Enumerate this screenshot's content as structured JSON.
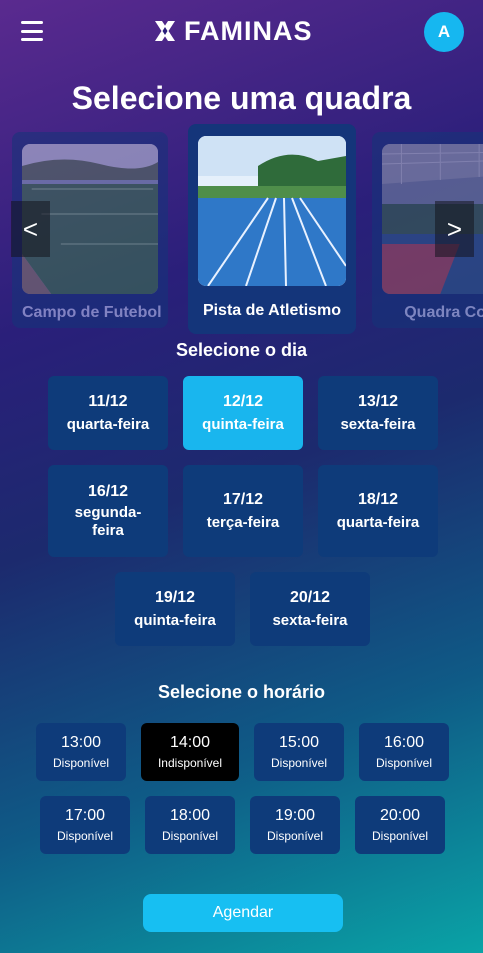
{
  "header": {
    "brand": "FAMINAS",
    "avatar_initial": "A"
  },
  "title": "Selecione uma quadra",
  "courts": [
    {
      "name": "Campo de Futebol"
    },
    {
      "name": "Pista de Atletismo"
    },
    {
      "name": "Quadra Cob"
    }
  ],
  "carousel": {
    "prev": "<",
    "next": ">"
  },
  "day_section": {
    "title": "Selecione o dia",
    "days": [
      {
        "date": "11/12",
        "weekday": "quarta-feira"
      },
      {
        "date": "12/12",
        "weekday": "quinta-feira"
      },
      {
        "date": "13/12",
        "weekday": "sexta-feira"
      },
      {
        "date": "16/12",
        "weekday": "segunda-feira"
      },
      {
        "date": "17/12",
        "weekday": "terça-feira"
      },
      {
        "date": "18/12",
        "weekday": "quarta-feira"
      },
      {
        "date": "19/12",
        "weekday": "quinta-feira"
      },
      {
        "date": "20/12",
        "weekday": "sexta-feira"
      }
    ]
  },
  "time_section": {
    "title": "Selecione o horário",
    "slots": [
      {
        "time": "13:00",
        "status": "Disponível"
      },
      {
        "time": "14:00",
        "status": "Indisponível"
      },
      {
        "time": "15:00",
        "status": "Disponível"
      },
      {
        "time": "16:00",
        "status": "Disponível"
      },
      {
        "time": "17:00",
        "status": "Disponível"
      },
      {
        "time": "18:00",
        "status": "Disponível"
      },
      {
        "time": "19:00",
        "status": "Disponível"
      },
      {
        "time": "20:00",
        "status": "Disponível"
      }
    ]
  },
  "actions": {
    "schedule": "Agendar"
  },
  "colors": {
    "accent": "#19b6ee",
    "button": "#0e3b7a"
  }
}
